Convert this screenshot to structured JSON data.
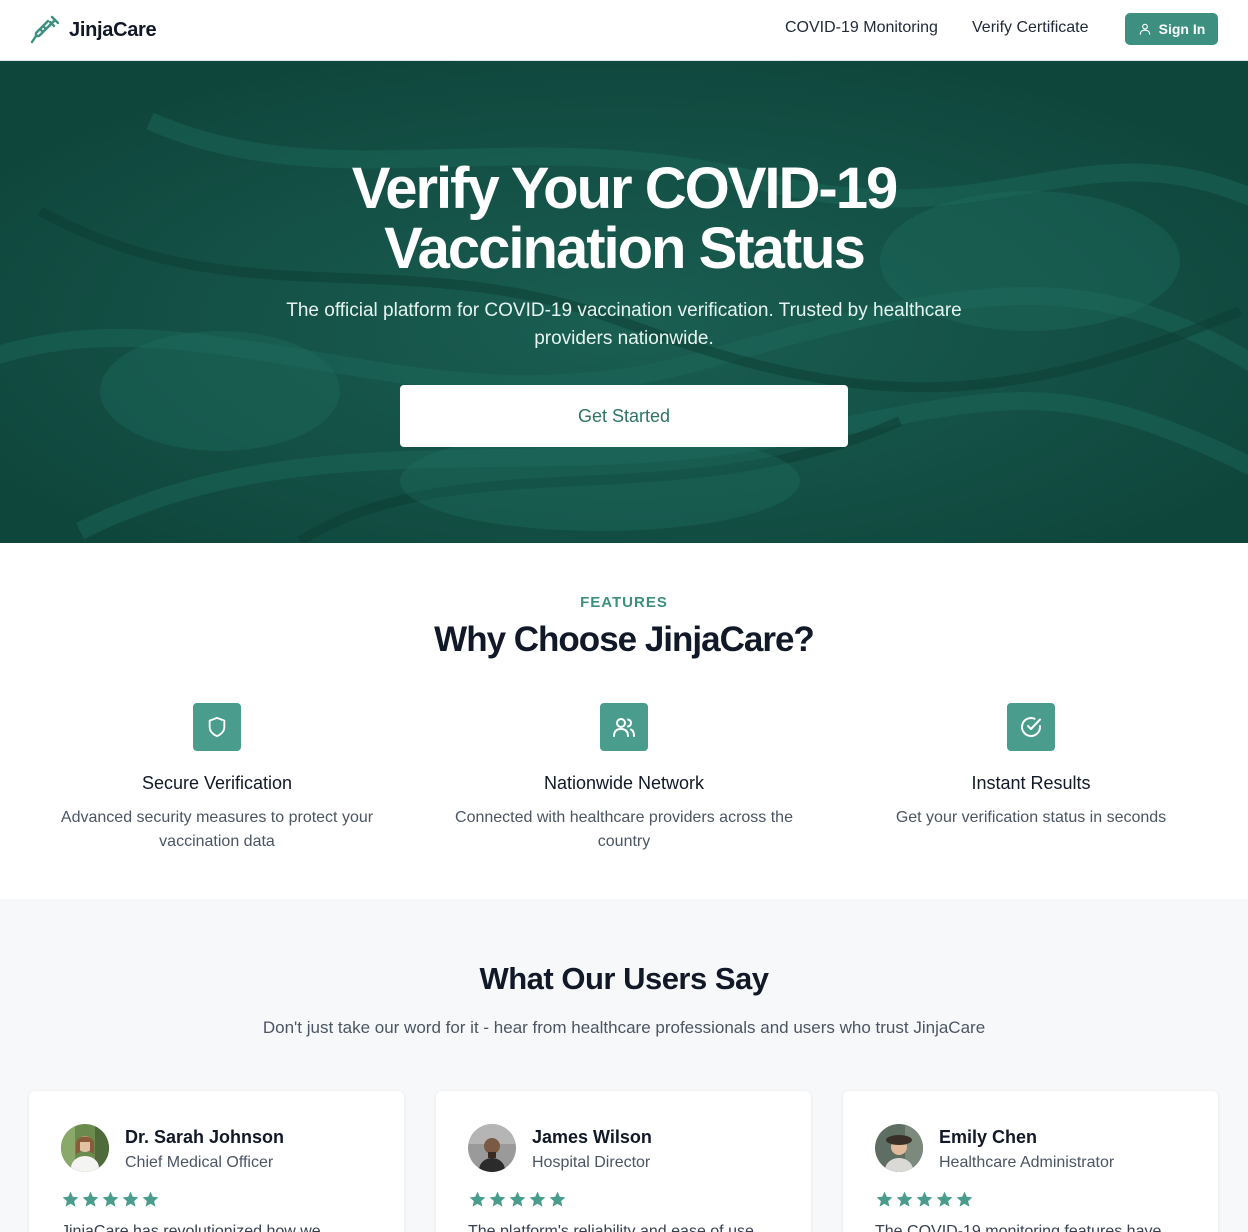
{
  "nav": {
    "brand": "JinjaCare",
    "links": [
      "COVID-19 Monitoring",
      "Verify Certificate"
    ],
    "signin_label": "Sign In"
  },
  "hero": {
    "title_line1": "Verify Your COVID-19",
    "title_line2": "Vaccination Status",
    "subtitle": "The official platform for COVID-19 vaccination verification. Trusted by healthcare providers nationwide.",
    "cta_label": "Get Started"
  },
  "features": {
    "kicker": "FEATURES",
    "title": "Why Choose JinjaCare?",
    "items": [
      {
        "icon": "shield-icon",
        "name": "Secure Verification",
        "desc": "Advanced security measures to protect your vaccination data"
      },
      {
        "icon": "users-icon",
        "name": "Nationwide Network",
        "desc": "Connected with healthcare providers across the country"
      },
      {
        "icon": "check-circle-icon",
        "name": "Instant Results",
        "desc": "Get your verification status in seconds"
      }
    ]
  },
  "testimonials": {
    "title": "What Our Users Say",
    "subtitle": "Don't just take our word for it - hear from healthcare professionals and users who trust JinjaCare",
    "items": [
      {
        "name": "Dr. Sarah Johnson",
        "role": "Chief Medical Officer",
        "rating": 5,
        "quote": "JinjaCare has revolutionized how we"
      },
      {
        "name": "James Wilson",
        "role": "Hospital Director",
        "rating": 5,
        "quote": "The platform's reliability and ease of use"
      },
      {
        "name": "Emily Chen",
        "role": "Healthcare Administrator",
        "rating": 5,
        "quote": "The COVID-19 monitoring features have"
      }
    ]
  },
  "colors": {
    "accent": "#3d8f80",
    "hero_bg": "#134f44",
    "star": "#4a9d8c"
  }
}
